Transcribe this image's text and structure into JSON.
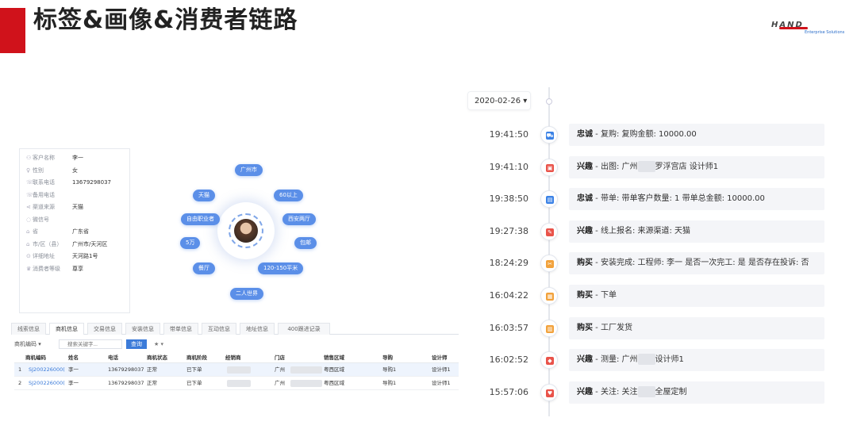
{
  "slide": {
    "title": "标签&画像&消费者链路",
    "logo_text": "HAND",
    "logo_sub": "Enterprise Solutions",
    "accent": "#d0121b"
  },
  "customer": {
    "fields": [
      {
        "icon": "user-icon",
        "label": "客户名称",
        "value": "李一"
      },
      {
        "icon": "gender-icon",
        "label": "性别",
        "value": "女"
      },
      {
        "icon": "phone-icon",
        "label": "联系电话",
        "value": "13679298037"
      },
      {
        "icon": "phone-icon",
        "label": "备用电话",
        "value": ""
      },
      {
        "icon": "share-icon",
        "label": "渠道来源",
        "value": "天猫"
      },
      {
        "icon": "wechat-icon",
        "label": "微信号",
        "value": ""
      },
      {
        "icon": "map-icon",
        "label": "省",
        "value": "广东省"
      },
      {
        "icon": "map-icon",
        "label": "市/区（县）",
        "value": "广州市/天河区"
      },
      {
        "icon": "location-icon",
        "label": "详细地址",
        "value": "天河路1号"
      },
      {
        "icon": "crown-icon",
        "label": "消费者等级",
        "value": "尊享"
      }
    ]
  },
  "tags": [
    "广州市",
    "天猫",
    "60以上",
    "自由职业者",
    "西安两厅",
    "5万",
    "包邮",
    "餐厅",
    "120-150平米",
    "二人世界"
  ],
  "tabs": [
    {
      "label": "线索信息",
      "active": false
    },
    {
      "label": "商机信息",
      "active": true
    },
    {
      "label": "交易信息",
      "active": false
    },
    {
      "label": "安装信息",
      "active": false
    },
    {
      "label": "带单信息",
      "active": false
    },
    {
      "label": "互动信息",
      "active": false
    },
    {
      "label": "地址信息",
      "active": false
    },
    {
      "label": "400跟进记录",
      "active": false
    }
  ],
  "query": {
    "select_label": "商机编码",
    "input_placeholder": "搜索关键字...",
    "button_label": "查询",
    "star_label": "★ ▾"
  },
  "table": {
    "headers": [
      "商机编码",
      "姓名",
      "电话",
      "商机状态",
      "商机阶段",
      "经销商",
      "门店",
      "销售区域",
      "导购",
      "设计师"
    ],
    "rows": [
      {
        "index": "1",
        "code": "SJ200226000(",
        "name": "李一",
        "phone": "13679298037",
        "status": "正常",
        "stage": "已下单",
        "store": "广州",
        "region": "粤西区域",
        "guide": "导购1",
        "designer": "设计师1",
        "selected": true
      },
      {
        "index": "2",
        "code": "SJ200226000(",
        "name": "李一",
        "phone": "13679298037",
        "status": "正常",
        "stage": "已下单",
        "store": "广州",
        "region": "粤西区域",
        "guide": "导购1",
        "designer": "设计师1",
        "selected": false
      }
    ]
  },
  "timeline": {
    "date": "2020-02-26 ▾",
    "events": [
      {
        "time": "19:41:50",
        "icon": "cart-icon",
        "color": "#3b82e6",
        "category": "忠诚",
        "pre": " - 复购: 复购金额: 10000.00",
        "mask": false,
        "post": ""
      },
      {
        "time": "19:41:10",
        "icon": "image-icon",
        "color": "#e9534a",
        "category": "兴趣",
        "pre": " - 出图: 广州",
        "mask": true,
        "post": "罗浮宫店 设计师1"
      },
      {
        "time": "19:38:50",
        "icon": "clipboard-icon",
        "color": "#3b82e6",
        "category": "忠诚",
        "pre": " - 带单: 带单客户数量: 1 带单总金额: 10000.00",
        "mask": false,
        "post": ""
      },
      {
        "time": "19:27:38",
        "icon": "edit-icon",
        "color": "#e9534a",
        "category": "兴趣",
        "pre": " - 线上报名: 来源渠道: 天猫",
        "mask": false,
        "post": ""
      },
      {
        "time": "18:24:29",
        "icon": "tools-icon",
        "color": "#f2a23c",
        "category": "购买",
        "pre": " - 安装完成: 工程师: 李一 是否一次完工: 是 是否存在投诉: 否",
        "mask": false,
        "post": ""
      },
      {
        "time": "16:04:22",
        "icon": "order-icon",
        "color": "#f2a23c",
        "category": "购买",
        "pre": " - 下单",
        "mask": false,
        "post": ""
      },
      {
        "time": "16:03:57",
        "icon": "box-icon",
        "color": "#f2a23c",
        "category": "购买",
        "pre": " - 工厂发货",
        "mask": false,
        "post": ""
      },
      {
        "time": "16:02:52",
        "icon": "ruler-icon",
        "color": "#e9534a",
        "category": "兴趣",
        "pre": " - 测量: 广州",
        "mask": true,
        "post": "设计师1"
      },
      {
        "time": "15:57:06",
        "icon": "heart-icon",
        "color": "#e9534a",
        "category": "兴趣",
        "pre": " - 关注: 关注",
        "mask": true,
        "post": "全屋定制"
      }
    ]
  }
}
